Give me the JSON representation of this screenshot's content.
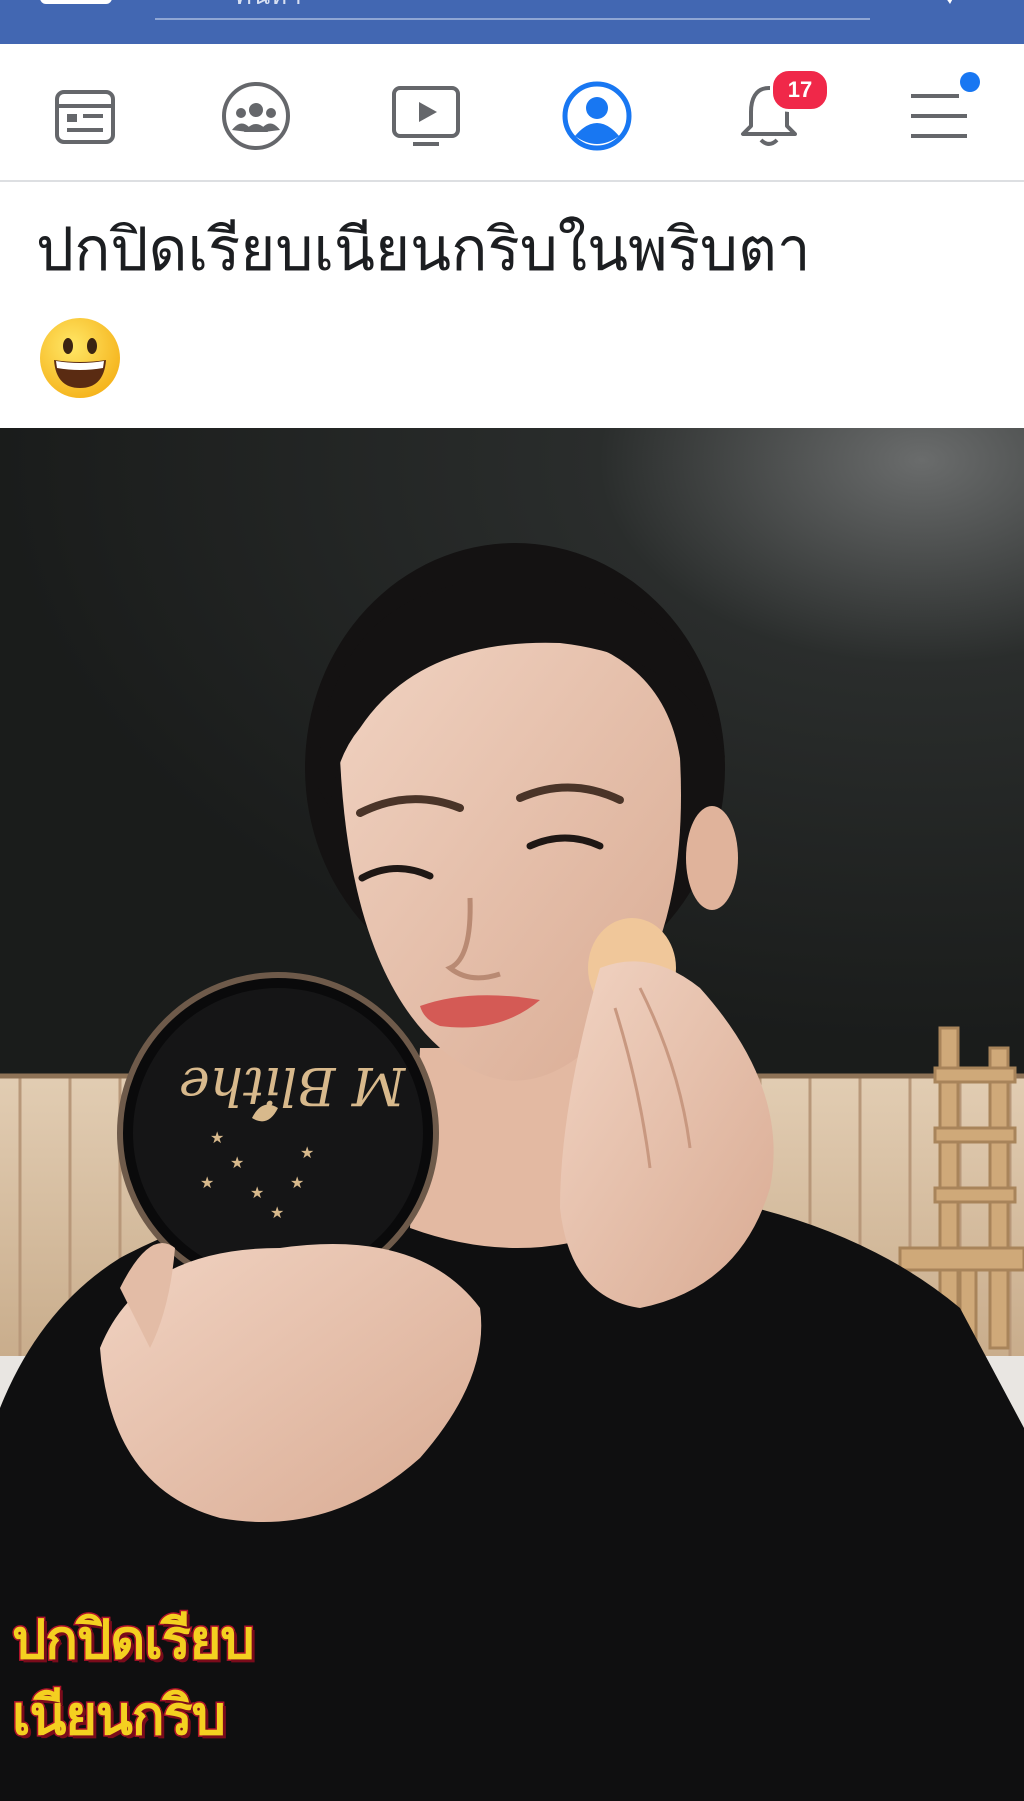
{
  "topbar": {
    "search_text": "ค้นหา"
  },
  "nav": {
    "items": [
      {
        "name": "news-feed-icon"
      },
      {
        "name": "groups-icon"
      },
      {
        "name": "watch-icon"
      },
      {
        "name": "profile-icon"
      },
      {
        "name": "notifications-icon"
      },
      {
        "name": "menu-icon"
      }
    ],
    "notifications_badge": "17",
    "active_color": "#1877f2",
    "inactive_color": "#65676b",
    "badge_color": "#f02849"
  },
  "post": {
    "text": "ปกปิดเรียบเนียนกริบในพริบตา",
    "emoji": "grinning-face-emoji",
    "image_caption_line1": "ปกปิดเรียบ",
    "image_caption_line2": "เนียนกริบ",
    "product_logo": "M Blithe"
  },
  "colors": {
    "topbar": "#4267b2",
    "caption_fill": "#f4d020",
    "caption_stroke": "#b0122a"
  }
}
